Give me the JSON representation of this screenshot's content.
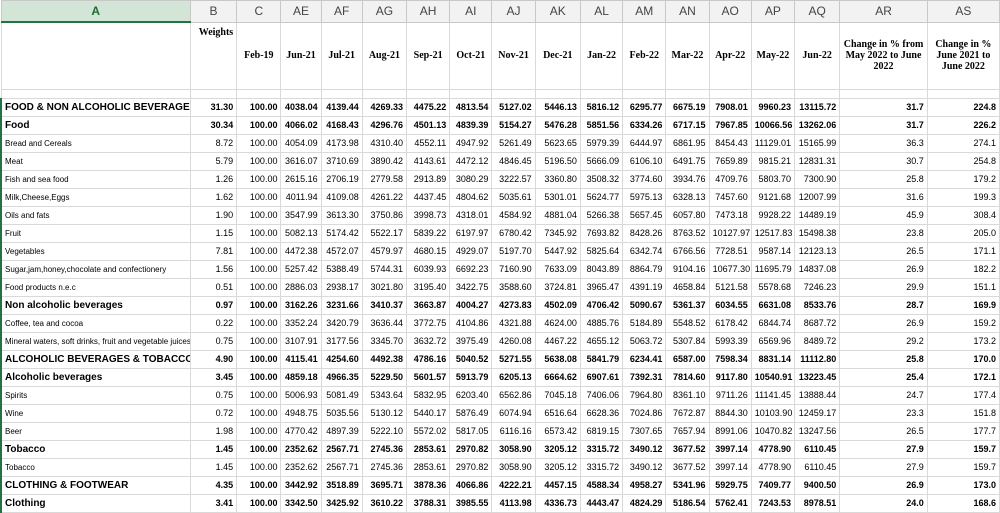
{
  "column_letters": [
    "A",
    "B",
    "C",
    "AE",
    "AF",
    "AG",
    "AH",
    "AI",
    "AJ",
    "AK",
    "AL",
    "AM",
    "AN",
    "AO",
    "AP",
    "AQ",
    "AR",
    "AS"
  ],
  "selected_column": "A",
  "header_row": {
    "label": "",
    "weights": "Weights",
    "months": [
      "Feb-19",
      "Jun-21",
      "Jul-21",
      "Aug-21",
      "Sep-21",
      "Oct-21",
      "Nov-21",
      "Dec-21",
      "Jan-22",
      "Feb-22",
      "Mar-22",
      "Apr-22",
      "May-22",
      "Jun-22"
    ],
    "change_may": "Change in % from May 2022 to June 2022",
    "change_june": "Change in % June 2021 to June 2022"
  },
  "rows": [
    {
      "label": "FOOD & NON ALCOHOLIC BEVERAGES",
      "bold": true,
      "weight": "31.30",
      "values": [
        "100.00",
        "4038.04",
        "4139.44",
        "4269.33",
        "4475.22",
        "4813.54",
        "5127.02",
        "5446.13",
        "5816.12",
        "6295.77",
        "6675.19",
        "7908.01",
        "9960.23",
        "13115.72"
      ],
      "chg_may": "31.7",
      "chg_year": "224.8"
    },
    {
      "label": "Food",
      "bold": true,
      "weight": "30.34",
      "values": [
        "100.00",
        "4066.02",
        "4168.43",
        "4296.76",
        "4501.13",
        "4839.39",
        "5154.27",
        "5476.28",
        "5851.56",
        "6334.26",
        "6717.15",
        "7967.85",
        "10066.56",
        "13262.06"
      ],
      "chg_may": "31.7",
      "chg_year": "226.2"
    },
    {
      "label": "Bread and Cereals",
      "bold": false,
      "weight": "8.72",
      "values": [
        "100.00",
        "4054.09",
        "4173.98",
        "4310.40",
        "4552.11",
        "4947.92",
        "5261.49",
        "5623.65",
        "5979.39",
        "6444.97",
        "6861.95",
        "8454.43",
        "11129.01",
        "15165.99"
      ],
      "chg_may": "36.3",
      "chg_year": "274.1"
    },
    {
      "label": "Meat",
      "bold": false,
      "weight": "5.79",
      "values": [
        "100.00",
        "3616.07",
        "3710.69",
        "3890.42",
        "4143.61",
        "4472.12",
        "4846.45",
        "5196.50",
        "5666.09",
        "6106.10",
        "6491.75",
        "7659.89",
        "9815.21",
        "12831.31"
      ],
      "chg_may": "30.7",
      "chg_year": "254.8"
    },
    {
      "label": "Fish and sea food",
      "bold": false,
      "weight": "1.26",
      "values": [
        "100.00",
        "2615.16",
        "2706.19",
        "2779.58",
        "2913.89",
        "3080.29",
        "3222.57",
        "3360.80",
        "3508.32",
        "3774.60",
        "3934.76",
        "4709.76",
        "5803.70",
        "7300.90"
      ],
      "chg_may": "25.8",
      "chg_year": "179.2"
    },
    {
      "label": "Milk,Cheese,Eggs",
      "bold": false,
      "weight": "1.62",
      "values": [
        "100.00",
        "4011.94",
        "4109.08",
        "4261.22",
        "4437.45",
        "4804.62",
        "5035.61",
        "5301.01",
        "5624.77",
        "5975.13",
        "6328.13",
        "7457.60",
        "9121.68",
        "12007.99"
      ],
      "chg_may": "31.6",
      "chg_year": "199.3"
    },
    {
      "label": "Oils and fats",
      "bold": false,
      "weight": "1.90",
      "values": [
        "100.00",
        "3547.99",
        "3613.30",
        "3750.86",
        "3998.73",
        "4318.01",
        "4584.92",
        "4881.04",
        "5266.38",
        "5657.45",
        "6057.80",
        "7473.18",
        "9928.22",
        "14489.19"
      ],
      "chg_may": "45.9",
      "chg_year": "308.4"
    },
    {
      "label": "Fruit",
      "bold": false,
      "weight": "1.15",
      "values": [
        "100.00",
        "5082.13",
        "5174.42",
        "5522.17",
        "5839.22",
        "6197.97",
        "6780.42",
        "7345.92",
        "7693.82",
        "8428.26",
        "8763.52",
        "10127.97",
        "12517.83",
        "15498.38"
      ],
      "chg_may": "23.8",
      "chg_year": "205.0"
    },
    {
      "label": "Vegetables",
      "bold": false,
      "weight": "7.81",
      "values": [
        "100.00",
        "4472.38",
        "4572.07",
        "4579.97",
        "4680.15",
        "4929.07",
        "5197.70",
        "5447.92",
        "5825.64",
        "6342.74",
        "6766.56",
        "7728.51",
        "9587.14",
        "12123.13"
      ],
      "chg_may": "26.5",
      "chg_year": "171.1"
    },
    {
      "label": "Sugar,jam,honey,chocolate and confectionery",
      "bold": false,
      "weight": "1.56",
      "values": [
        "100.00",
        "5257.42",
        "5388.49",
        "5744.31",
        "6039.93",
        "6692.23",
        "7160.90",
        "7633.09",
        "8043.89",
        "8864.79",
        "9104.16",
        "10677.30",
        "11695.79",
        "14837.08"
      ],
      "chg_may": "26.9",
      "chg_year": "182.2"
    },
    {
      "label": "Food products n.e.c",
      "bold": false,
      "weight": "0.51",
      "values": [
        "100.00",
        "2886.03",
        "2938.17",
        "3021.80",
        "3195.40",
        "3422.75",
        "3588.60",
        "3724.81",
        "3965.47",
        "4391.19",
        "4658.84",
        "5121.58",
        "5578.68",
        "7246.23"
      ],
      "chg_may": "29.9",
      "chg_year": "151.1"
    },
    {
      "label": "Non alcoholic beverages",
      "bold": true,
      "weight": "0.97",
      "values": [
        "100.00",
        "3162.26",
        "3231.66",
        "3410.37",
        "3663.87",
        "4004.27",
        "4273.83",
        "4502.09",
        "4706.42",
        "5090.67",
        "5361.37",
        "6034.55",
        "6631.08",
        "8533.76"
      ],
      "chg_may": "28.7",
      "chg_year": "169.9"
    },
    {
      "label": "Coffee, tea and cocoa",
      "bold": false,
      "weight": "0.22",
      "values": [
        "100.00",
        "3352.24",
        "3420.79",
        "3636.44",
        "3772.75",
        "4104.86",
        "4321.88",
        "4624.00",
        "4885.76",
        "5184.89",
        "5548.52",
        "6178.42",
        "6844.74",
        "8687.72"
      ],
      "chg_may": "26.9",
      "chg_year": "159.2"
    },
    {
      "label": "Mineral waters, soft drinks, fruit and vegetable juices",
      "bold": false,
      "weight": "0.75",
      "values": [
        "100.00",
        "3107.91",
        "3177.56",
        "3345.70",
        "3632.72",
        "3975.49",
        "4260.08",
        "4467.22",
        "4655.12",
        "5063.72",
        "5307.84",
        "5993.39",
        "6569.96",
        "8489.72"
      ],
      "chg_may": "29.2",
      "chg_year": "173.2"
    },
    {
      "label": "ALCOHOLIC BEVERAGES & TOBACCO",
      "bold": true,
      "weight": "4.90",
      "values": [
        "100.00",
        "4115.41",
        "4254.60",
        "4492.38",
        "4786.16",
        "5040.52",
        "5271.55",
        "5638.08",
        "5841.79",
        "6234.41",
        "6587.00",
        "7598.34",
        "8831.14",
        "11112.80"
      ],
      "chg_may": "25.8",
      "chg_year": "170.0"
    },
    {
      "label": "Alcoholic beverages",
      "bold": true,
      "weight": "3.45",
      "values": [
        "100.00",
        "4859.18",
        "4966.35",
        "5229.50",
        "5601.57",
        "5913.79",
        "6205.13",
        "6664.62",
        "6907.61",
        "7392.31",
        "7814.60",
        "9117.80",
        "10540.91",
        "13223.45"
      ],
      "chg_may": "25.4",
      "chg_year": "172.1"
    },
    {
      "label": "Spirits",
      "bold": false,
      "weight": "0.75",
      "values": [
        "100.00",
        "5006.93",
        "5081.49",
        "5343.64",
        "5832.95",
        "6203.40",
        "6562.86",
        "7045.18",
        "7406.06",
        "7964.80",
        "8361.10",
        "9711.26",
        "11141.45",
        "13888.44"
      ],
      "chg_may": "24.7",
      "chg_year": "177.4"
    },
    {
      "label": "Wine",
      "bold": false,
      "weight": "0.72",
      "values": [
        "100.00",
        "4948.75",
        "5035.56",
        "5130.12",
        "5440.17",
        "5876.49",
        "6074.94",
        "6516.64",
        "6628.36",
        "7024.86",
        "7672.87",
        "8844.30",
        "10103.90",
        "12459.17"
      ],
      "chg_may": "23.3",
      "chg_year": "151.8"
    },
    {
      "label": "Beer",
      "bold": false,
      "weight": "1.98",
      "values": [
        "100.00",
        "4770.42",
        "4897.39",
        "5222.10",
        "5572.02",
        "5817.05",
        "6116.16",
        "6573.42",
        "6819.15",
        "7307.65",
        "7657.94",
        "8991.06",
        "10470.82",
        "13247.56"
      ],
      "chg_may": "26.5",
      "chg_year": "177.7"
    },
    {
      "label": "Tobacco",
      "bold": true,
      "weight": "1.45",
      "values": [
        "100.00",
        "2352.62",
        "2567.71",
        "2745.36",
        "2853.61",
        "2970.82",
        "3058.90",
        "3205.12",
        "3315.72",
        "3490.12",
        "3677.52",
        "3997.14",
        "4778.90",
        "6110.45"
      ],
      "chg_may": "27.9",
      "chg_year": "159.7"
    },
    {
      "label": "Tobacco",
      "bold": false,
      "weight": "1.45",
      "values": [
        "100.00",
        "2352.62",
        "2567.71",
        "2745.36",
        "2853.61",
        "2970.82",
        "3058.90",
        "3205.12",
        "3315.72",
        "3490.12",
        "3677.52",
        "3997.14",
        "4778.90",
        "6110.45"
      ],
      "chg_may": "27.9",
      "chg_year": "159.7"
    },
    {
      "label": "CLOTHING & FOOTWEAR",
      "bold": true,
      "weight": "4.35",
      "values": [
        "100.00",
        "3442.92",
        "3518.89",
        "3695.71",
        "3878.36",
        "4066.86",
        "4222.21",
        "4457.15",
        "4588.34",
        "4958.27",
        "5341.96",
        "5929.75",
        "7409.77",
        "9400.50"
      ],
      "chg_may": "26.9",
      "chg_year": "173.0"
    },
    {
      "label": "Clothing",
      "bold": true,
      "weight": "3.41",
      "values": [
        "100.00",
        "3342.50",
        "3425.92",
        "3610.22",
        "3788.31",
        "3985.55",
        "4113.98",
        "4336.73",
        "4443.47",
        "4824.29",
        "5186.54",
        "5762.41",
        "7243.53",
        "8978.51"
      ],
      "chg_may": "24.0",
      "chg_year": "168.6"
    }
  ]
}
